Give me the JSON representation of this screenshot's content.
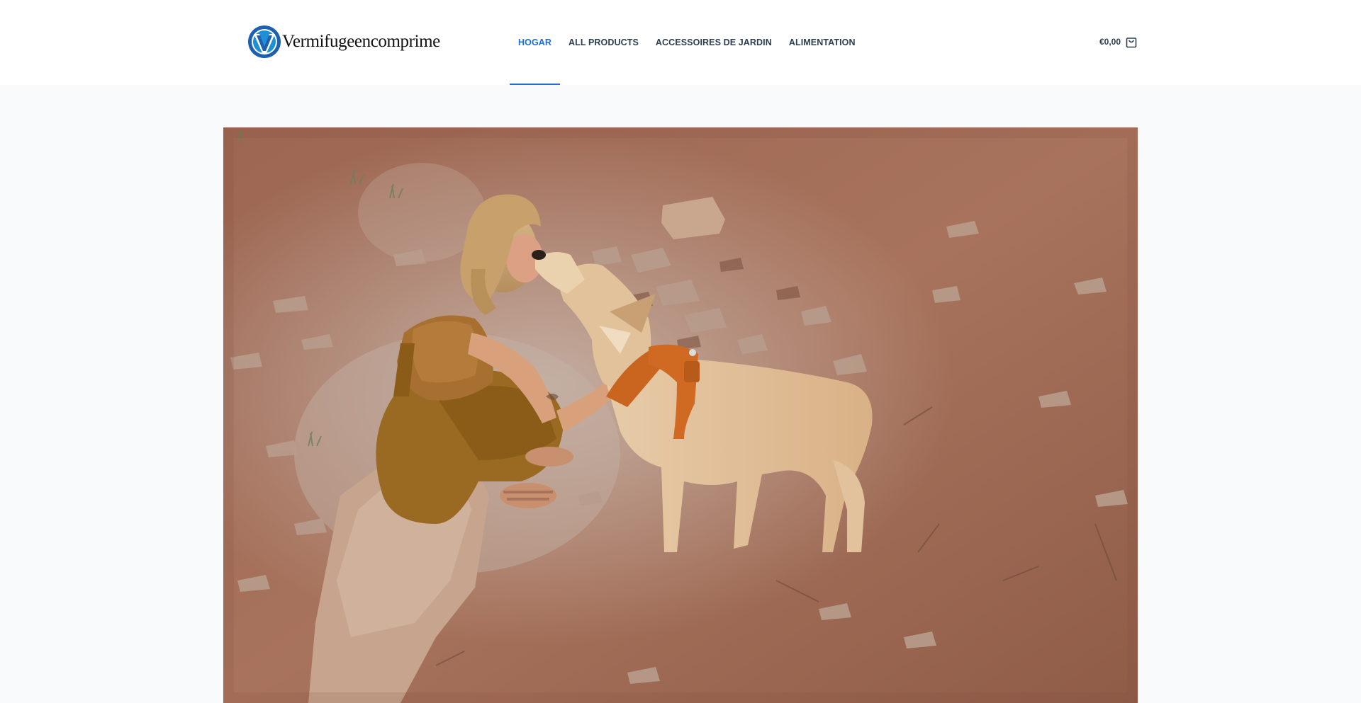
{
  "site": {
    "logo_text": "Vermifugeencomprime",
    "logo_icon": "w-circle-logo-icon",
    "brand_color": "#1e6fd9"
  },
  "nav": {
    "items": [
      {
        "label": "HOGAR",
        "active": true
      },
      {
        "label": "ALL PRODUCTS",
        "active": false
      },
      {
        "label": "ACCESSOIRES DE JARDIN",
        "active": false
      },
      {
        "label": "ALIMENTATION",
        "active": false
      }
    ]
  },
  "cart": {
    "total": "€0,00",
    "icon": "shopping-bag-icon"
  },
  "hero": {
    "image": "woman-kissing-dog-photo"
  }
}
